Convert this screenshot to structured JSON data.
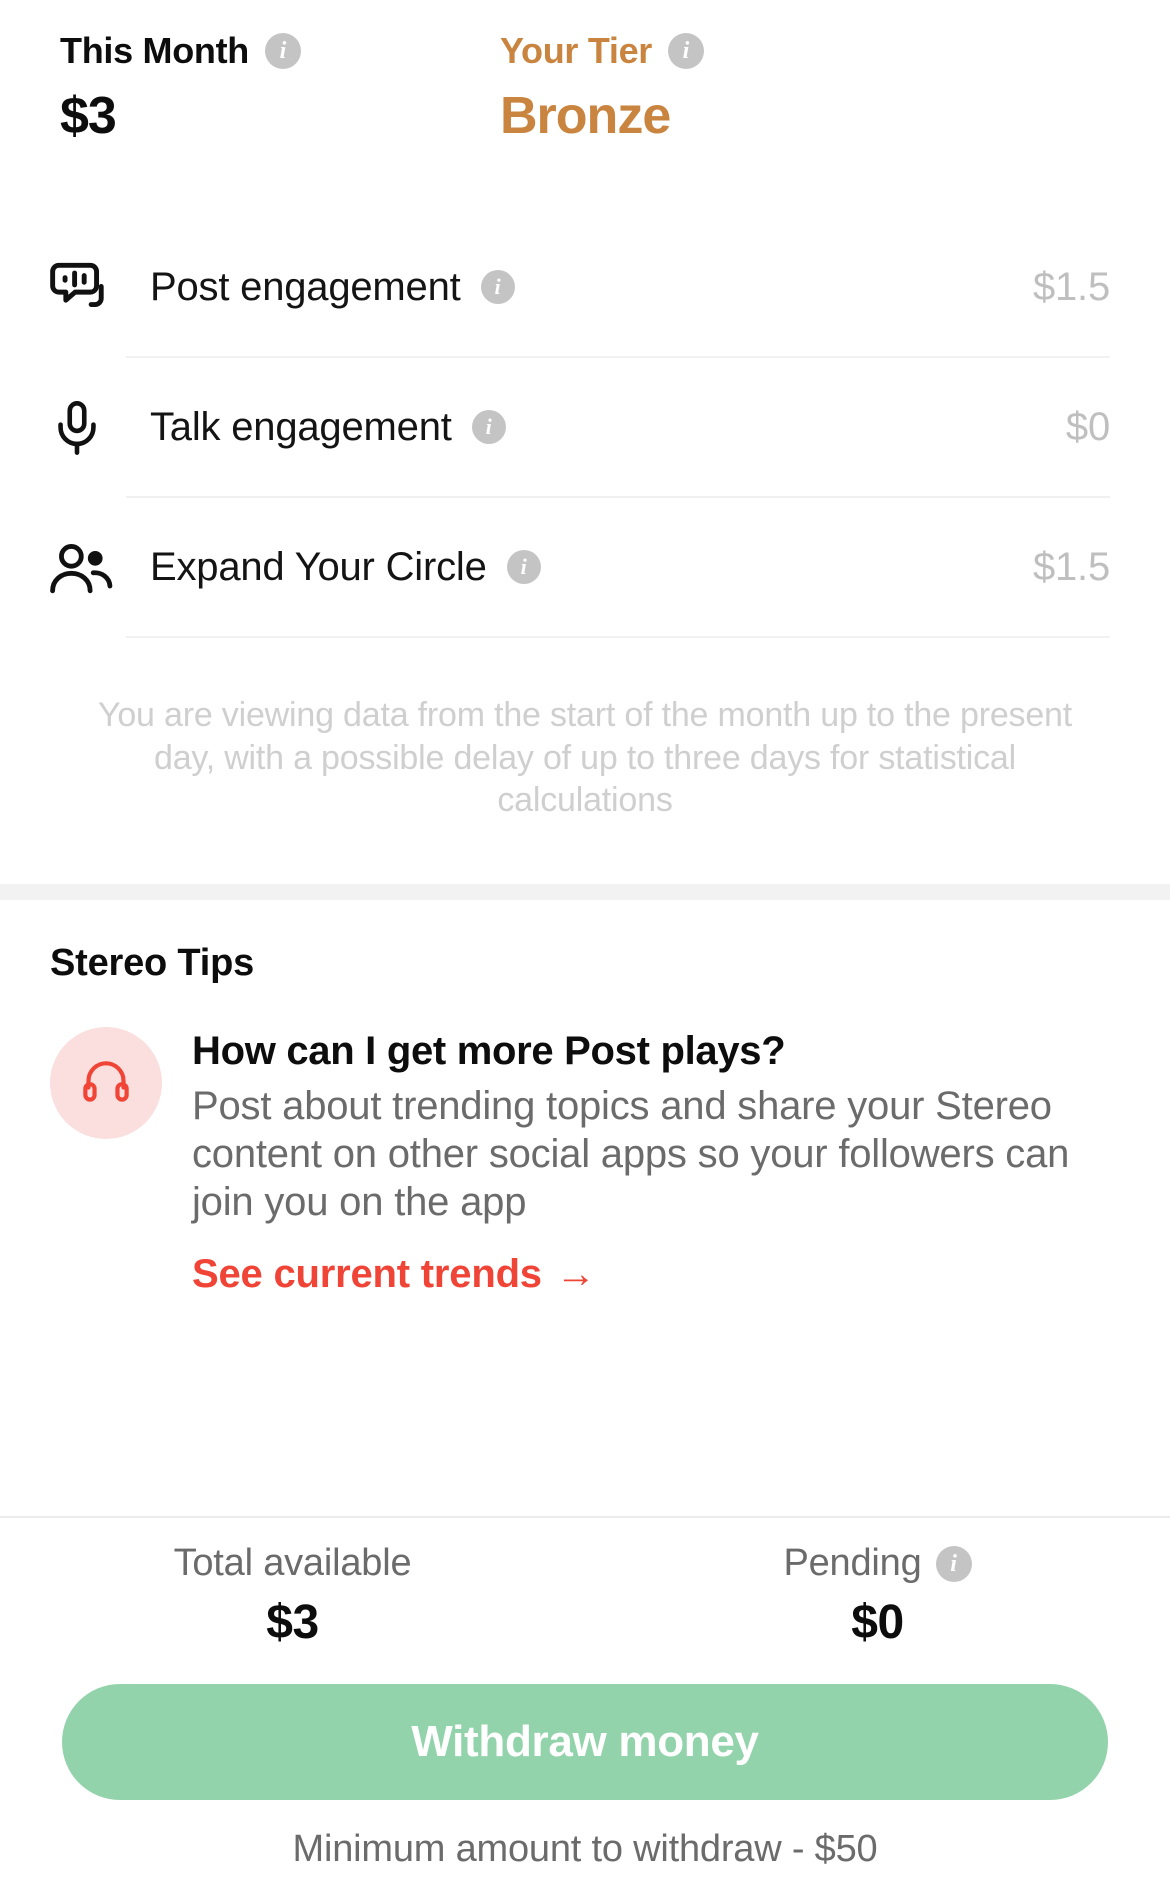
{
  "summary": {
    "month_label": "This Month",
    "month_value": "$3",
    "tier_label": "Your Tier",
    "tier_value": "Bronze",
    "tier_color": "#C9853F",
    "info_glyph": "i"
  },
  "earnings": {
    "rows": [
      {
        "icon": "post-engagement-icon",
        "name": "Post engagement",
        "amount": "$1.5"
      },
      {
        "icon": "microphone-icon",
        "name": "Talk engagement",
        "amount": "$0"
      },
      {
        "icon": "people-icon",
        "name": "Expand Your Circle",
        "amount": "$1.5"
      }
    ],
    "disclaimer": "You are viewing data from the start of the month up to the present day, with a possible delay of up to three days for statistical calculations"
  },
  "tips": {
    "title": "Stereo Tips",
    "question": "How can I get more Post plays?",
    "answer": "Post about trending topics and share your Stereo content on other social apps so your followers can join you on the app",
    "link_label": "See current trends",
    "link_arrow": "→",
    "link_color": "#EF4436",
    "avatar_icon": "headphones-icon",
    "avatar_bg": "#FBDEDE"
  },
  "bottom": {
    "total_available_label": "Total available",
    "total_available_value": "$3",
    "pending_label": "Pending",
    "pending_value": "$0",
    "withdraw_label": "Withdraw money",
    "withdraw_color": "#93D3AB",
    "min_note": "Minimum amount to withdraw - $50"
  }
}
